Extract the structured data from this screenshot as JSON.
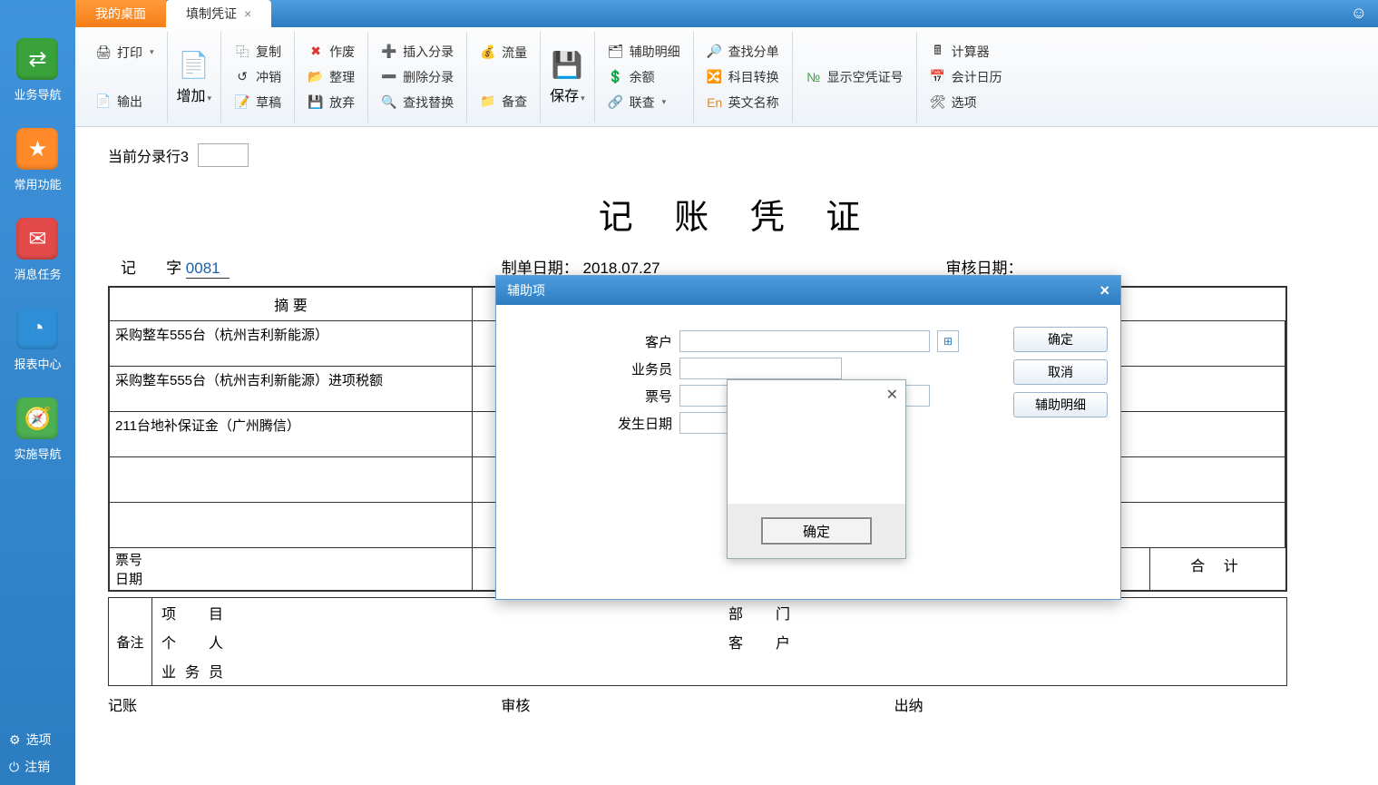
{
  "tabs": {
    "desktop": "我的桌面",
    "voucher": "填制凭证"
  },
  "sidebar": {
    "items": [
      {
        "label": "业务导航",
        "color": "#3aa23a"
      },
      {
        "label": "常用功能",
        "color": "#ff8a2a"
      },
      {
        "label": "消息任务",
        "color": "#e24a4a"
      },
      {
        "label": "报表中心",
        "color": "#2f8fd6"
      },
      {
        "label": "实施导航",
        "color": "#4caf50"
      }
    ],
    "options": "选项",
    "logout": "注销"
  },
  "ribbon": {
    "print": "打印",
    "export": "输出",
    "add": "增加",
    "copy": "复制",
    "offset": "冲销",
    "draft": "草稿",
    "void": "作废",
    "sort": "整理",
    "discard": "放弃",
    "insertEntry": "插入分录",
    "deleteEntry": "删除分录",
    "findReplace": "查找替换",
    "flow": "流量",
    "save": "保存",
    "check": "备查",
    "auxDetail": "辅助明细",
    "balance": "余额",
    "linkQuery": "联查",
    "findEntry": "查找分单",
    "subjectConvert": "科目转换",
    "englishName": "英文名称",
    "showEmpty": "显示空凭证号",
    "calc": "计算器",
    "calendar": "会计日历",
    "opts": "选项"
  },
  "page": {
    "currentRowLabel": "当前分录行3",
    "title": "记 账 凭 证",
    "recordPrefix": "记",
    "wordLabel": "字",
    "voucherNo": "0081",
    "makeDateLabel": "制单日期：",
    "makeDate": "2018.07.27",
    "auditDateLabel": "审核日期：",
    "summaryHeader": "摘 要",
    "rows": [
      "采购整车555台（杭州吉利新能源）",
      "采购整车555台（杭州吉利新能源）进项税额",
      "211台地补保证金（广州腾信）",
      "",
      ""
    ],
    "ticketLabel": "票号",
    "dateLabel": "日期",
    "totalLabel": "合 计",
    "remarksLabel": "备注",
    "remarks": {
      "project": "项　目",
      "dept": "部　门",
      "person": "个　人",
      "customer": "客　户",
      "sales": "业务员"
    },
    "signers": {
      "book": "记账",
      "audit": "审核",
      "cashier": "出纳"
    }
  },
  "modal": {
    "title": "辅助项",
    "fields": {
      "customer": "客户",
      "sales": "业务员",
      "ticket": "票号",
      "occurDate": "发生日期"
    },
    "ok": "确定",
    "cancel": "取消",
    "detail": "辅助明细"
  },
  "popup": {
    "ok": "确定"
  }
}
